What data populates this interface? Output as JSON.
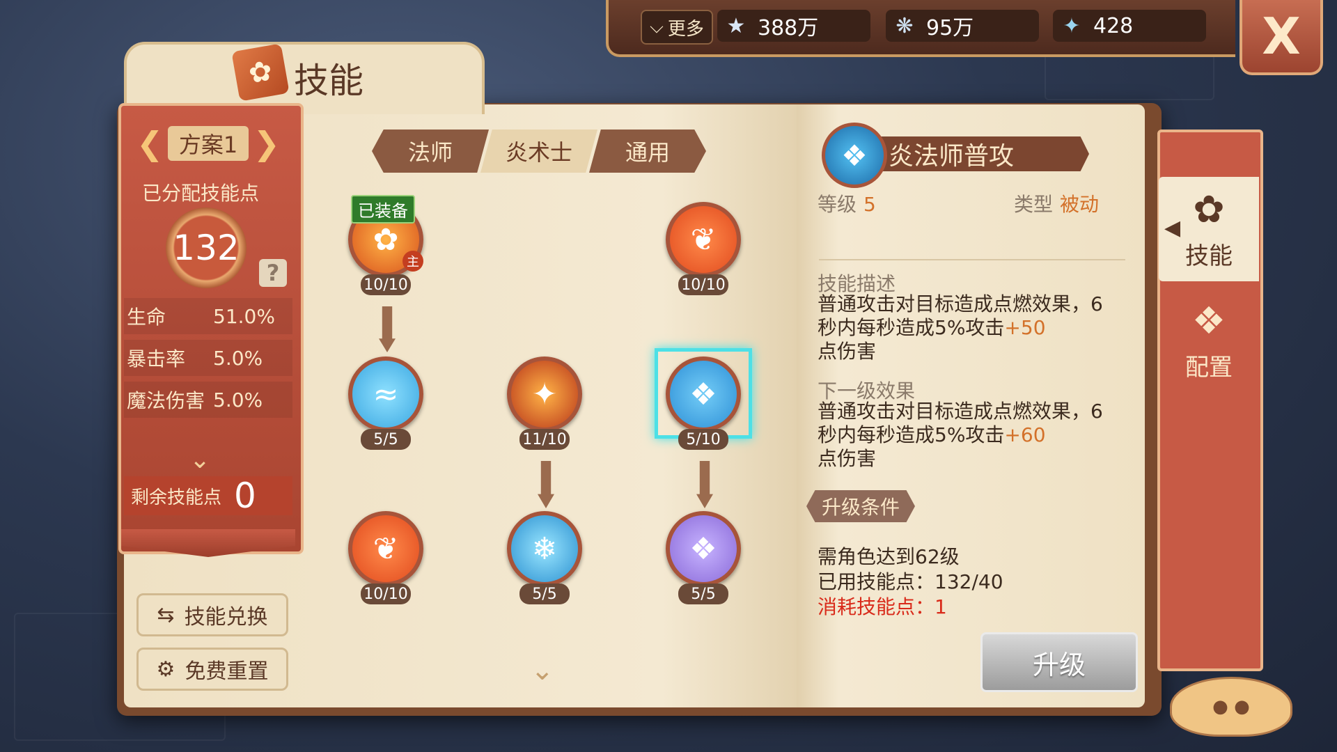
{
  "currency": {
    "more_label": "更多",
    "items": [
      {
        "icon": "star-icon",
        "value": "388万"
      },
      {
        "icon": "shell-icon",
        "value": "95万"
      },
      {
        "icon": "crystal-icon",
        "value": "428"
      }
    ]
  },
  "close_label": "X",
  "title": "技能",
  "left_panel": {
    "scheme": "方案1",
    "alloc_label": "已分配技能点",
    "alloc_points": "132",
    "help": "?",
    "stats": [
      {
        "label": "生命",
        "value": "51.0%"
      },
      {
        "label": "暴击率",
        "value": "5.0%"
      },
      {
        "label": "魔法伤害",
        "value": "5.0%"
      }
    ],
    "remain_label": "剩余技能点",
    "remain_value": "0",
    "exchange_label": "技能兑换",
    "reset_label": "免费重置"
  },
  "tabs": [
    "法师",
    "炎术士",
    "通用"
  ],
  "active_tab": 1,
  "skills": {
    "equipped_label": "已装备",
    "main_badge": "主",
    "nodes": [
      {
        "level": "10/10",
        "icon": "phoenix-fire-icon",
        "color": "#d8521c"
      },
      {
        "level": "10/10",
        "icon": "flame-rune-icon",
        "color": "#e14a1e"
      },
      {
        "level": "5/5",
        "icon": "water-wave-icon",
        "color": "#3aa6e0"
      },
      {
        "level": "11/10",
        "icon": "fire-pillar-icon",
        "color": "#b8361a"
      },
      {
        "level": "5/10",
        "icon": "blue-dragon-icon",
        "color": "#2d8fd6"
      },
      {
        "level": "10/10",
        "icon": "flame-rune-icon",
        "color": "#e14a1e"
      },
      {
        "level": "5/5",
        "icon": "ice-burst-icon",
        "color": "#2b90d0"
      },
      {
        "level": "5/5",
        "icon": "purple-dragon-icon",
        "color": "#8a6ad8"
      }
    ]
  },
  "detail": {
    "name": "炎法师普攻",
    "level_label": "等级",
    "level_value": "5",
    "type_label": "类型",
    "type_value": "被动",
    "desc_title": "技能描述",
    "desc_text": "普通攻击对目标造成点燃效果，6秒内每秒造成5%攻击",
    "desc_bonus": "+50",
    "desc_tail": "点伤害",
    "next_title": "下一级效果",
    "next_text": "普通攻击对目标造成点燃效果，6秒内每秒造成5%攻击",
    "next_bonus": "+60",
    "next_tail": "点伤害",
    "cond_label": "升级条件",
    "req_level": "需角色达到62级",
    "req_used": "已用技能点：132/40",
    "req_cost": "消耗技能点：1",
    "upgrade_label": "升级"
  },
  "side_tabs": [
    {
      "label": "技能",
      "icon": "skill-flame-icon"
    },
    {
      "label": "配置",
      "icon": "config-gem-icon"
    }
  ]
}
